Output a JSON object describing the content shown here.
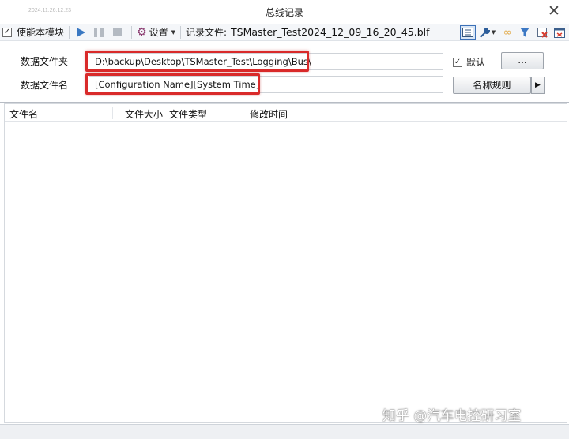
{
  "window": {
    "timestamp": "2024.11.26.12:23",
    "title": "总线记录",
    "close_glyph": "✕"
  },
  "toolbar": {
    "enable_checked": true,
    "enable_label": "使能本模块",
    "settings_label": "设置",
    "record_file_label": "记录文件:",
    "record_file_value": "TSMaster_Test2024_12_09_16_20_45.blf",
    "icons": [
      "play-icon",
      "pause-icon",
      "stop-icon",
      "gear-icon",
      "list-view-icon",
      "wrench-icon",
      "link-icon",
      "filter-icon",
      "delete-icon",
      "window-icon"
    ]
  },
  "config": {
    "folder_label": "数据文件夹",
    "folder_value": "D:\\backup\\Desktop\\TSMaster_Test\\Logging\\Bus\\",
    "default_checked": true,
    "default_label": "默认",
    "browse_label": "...",
    "filename_label": "数据文件名",
    "filename_value": "[Configuration Name][System Time]",
    "naming_rule_label": "名称规则",
    "highlight_color": "#d92a2a"
  },
  "table": {
    "columns": [
      "文件名",
      "文件大小",
      "文件类型",
      "修改时间"
    ],
    "rows": []
  },
  "watermark": "知乎 @汽车电控研习室"
}
